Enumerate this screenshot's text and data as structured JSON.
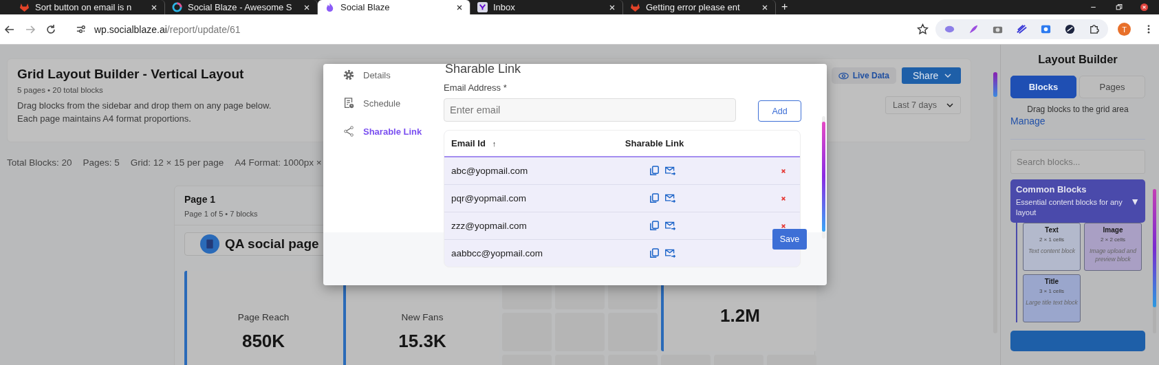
{
  "browser": {
    "tabs": [
      {
        "title": "Sort button on email is n",
        "kind": "gitlab",
        "selected": false
      },
      {
        "title": "Social Blaze - Awesome S",
        "kind": "ring",
        "selected": false
      },
      {
        "title": "Social Blaze",
        "kind": "blaze",
        "selected": true
      },
      {
        "title": "Inbox",
        "kind": "yahoo",
        "selected": false
      },
      {
        "title": "Getting error please ent",
        "kind": "gitlab",
        "selected": false
      }
    ],
    "new_tab": "+",
    "url_domain": "wp.socialblaze.ai",
    "url_path": "/report/update/61",
    "profile_initial": "T"
  },
  "header": {
    "title": "Grid Layout Builder - Vertical Layout",
    "subtitle": "5 pages • 20 total blocks",
    "description": [
      "Drag blocks from the sidebar and drop them on any page below.",
      "Each page maintains A4 format proportions."
    ],
    "live_data": "Live Data",
    "share": "Share",
    "date_range": "Last 7 days"
  },
  "stats": [
    "Total Blocks: 20",
    "Pages: 5",
    "Grid: 12 × 15 per page",
    "A4 Format: 1000px ×"
  ],
  "page": {
    "title": "Page 1",
    "subtitle": "Page 1 of 5 • 7 blocks",
    "heading_block": "QA social page",
    "metrics": [
      {
        "label": "Page Reach",
        "value": "850K"
      },
      {
        "label": "New Fans",
        "value": "15.3K"
      },
      {
        "value": "1.2M"
      }
    ]
  },
  "modal": {
    "nav": [
      {
        "label": "Details",
        "kind": "gear",
        "selected": false
      },
      {
        "label": "Schedule",
        "kind": "schedule",
        "selected": false
      },
      {
        "label": "Sharable Link",
        "kind": "share",
        "selected": true
      }
    ],
    "heading": "Sharable Link",
    "email_label": "Email Address *",
    "email_placeholder": "Enter email",
    "add": "Add",
    "columns": [
      "Email Id",
      "Sharable Link"
    ],
    "sort_indicator": "↑",
    "rows": [
      {
        "email": "abc@yopmail.com",
        "removable": true
      },
      {
        "email": "pqr@yopmail.com",
        "removable": true
      },
      {
        "email": "zzz@yopmail.com",
        "removable": true
      },
      {
        "email": "aabbcc@yopmail.com",
        "removable": false
      }
    ],
    "save": "Save"
  },
  "sidebar": {
    "title": "Layout Builder",
    "tabs": [
      {
        "label": "Blocks",
        "selected": true
      },
      {
        "label": "Pages",
        "selected": false
      }
    ],
    "hint": "Drag blocks to the grid area",
    "manage": "Manage",
    "search_placeholder": "Search blocks...",
    "category": {
      "title": "Common Blocks",
      "description": "Essential content blocks for any layout",
      "toggle": "▼",
      "blocks": [
        {
          "name": "Text",
          "size": "2 × 1 cells",
          "description": "Text content block",
          "color": "#b3b9cc"
        },
        {
          "name": "Image",
          "size": "2 × 2 cells",
          "description": "Image upload and preview block",
          "color": "#a99fc4"
        },
        {
          "name": "Title",
          "size": "3 × 1 cells",
          "description": "Large title text block",
          "color": "#9aa6cc"
        }
      ]
    }
  }
}
